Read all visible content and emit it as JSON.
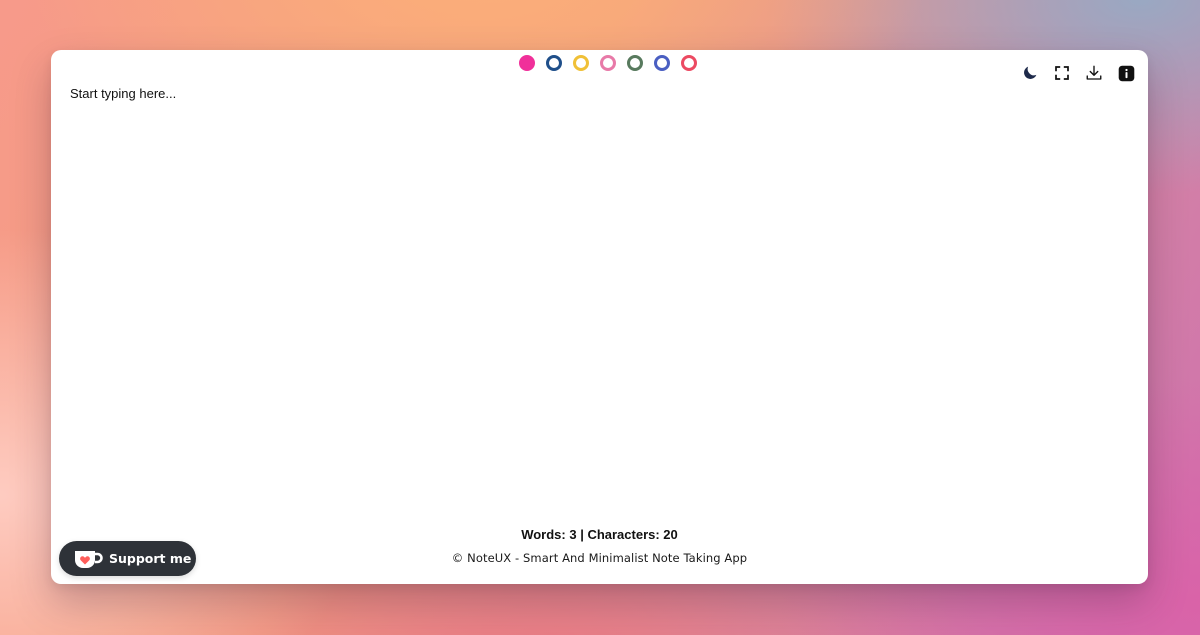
{
  "editor": {
    "placeholder": "Start typing here..."
  },
  "colors": [
    {
      "name": "pink",
      "hex": "#f0309a",
      "selected": true
    },
    {
      "name": "navy",
      "hex": "#1f4f8a",
      "selected": false
    },
    {
      "name": "yellow",
      "hex": "#f0c037",
      "selected": false
    },
    {
      "name": "rose",
      "hex": "#e87aa8",
      "selected": false
    },
    {
      "name": "green",
      "hex": "#587a5e",
      "selected": false
    },
    {
      "name": "blue",
      "hex": "#4a5fc2",
      "selected": false
    },
    {
      "name": "red",
      "hex": "#ec4a62",
      "selected": false
    }
  ],
  "toolbar": {
    "icons": [
      "moon-icon",
      "fullscreen-icon",
      "download-icon",
      "info-icon"
    ]
  },
  "stats": {
    "text": "Words: 3 | Characters: 20"
  },
  "footer": {
    "text": "© NoteUX - Smart And Minimalist Note Taking App"
  },
  "support": {
    "label": "Support me",
    "accent": "#ff5e5b"
  }
}
